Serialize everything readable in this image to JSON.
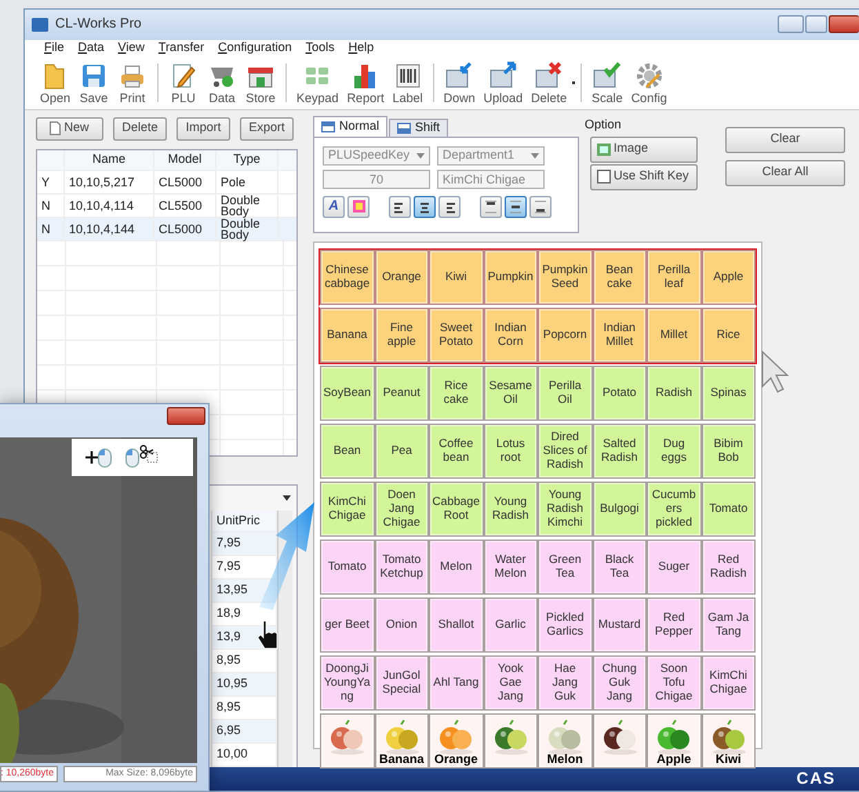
{
  "window": {
    "title": "CL-Works Pro"
  },
  "menu": [
    "File",
    "Data",
    "View",
    "Transfer",
    "Configuration",
    "Tools",
    "Help"
  ],
  "toolbar_groups": [
    [
      "Open",
      "Save",
      "Print"
    ],
    [
      "PLU",
      "Data",
      "Store"
    ],
    [
      "Keypad",
      "Report",
      "Label"
    ],
    [
      "Down",
      "Upload",
      "Delete"
    ],
    [
      "Scale",
      "Config"
    ]
  ],
  "scale_buttons": [
    "New",
    "Delete",
    "Import",
    "Export"
  ],
  "scale_table": {
    "columns": [
      "",
      "Name",
      "Model",
      "Type"
    ],
    "rows": [
      [
        "Y",
        "10,10,5,217",
        "CL5000",
        "Pole"
      ],
      [
        "N",
        "10,10,4,114",
        "CL5500",
        "Double Body"
      ],
      [
        "N",
        "10,10,4,144",
        "CL5000",
        "Double Body"
      ]
    ]
  },
  "price_table": {
    "column": "UnitPric",
    "values": [
      "7,95",
      "7,95",
      "13,95",
      "18,9",
      "13,9",
      "8,95",
      "10,95",
      "8,95",
      "6,95",
      "10,00"
    ]
  },
  "tabs": [
    {
      "label": "Normal",
      "selected": true
    },
    {
      "label": "Shift",
      "selected": false
    }
  ],
  "selects": [
    "PLUSpeedKey",
    "Department1"
  ],
  "fields": [
    "70",
    "KimChi Chigae"
  ],
  "style_buttons": [
    {
      "kind": "font",
      "label": "A"
    },
    {
      "kind": "color"
    }
  ],
  "align_buttons": [
    {
      "selected": false
    },
    {
      "selected": true
    },
    {
      "selected": false
    }
  ],
  "valign_buttons": [
    {
      "selected": false
    },
    {
      "selected": true
    },
    {
      "selected": false
    }
  ],
  "option": {
    "title": "Option",
    "buttons": [
      "Image",
      "Use Shift Key"
    ]
  },
  "clear_buttons": [
    "Clear",
    "Clear All"
  ],
  "key_rows": [
    {
      "kind": "text",
      "color": "#fcd27c",
      "selected": true,
      "keys": [
        "Chinese cabbage",
        "Orange",
        "Kiwi",
        "Pumpkin",
        "Pumpkin Seed",
        "Bean cake",
        "Perilla leaf",
        "Apple"
      ]
    },
    {
      "kind": "text",
      "color": "#fcd27c",
      "selected": true,
      "keys": [
        "Banana",
        "Fine apple",
        "Sweet Potato",
        "Indian Corn",
        "Popcorn",
        "Indian Millet",
        "Millet",
        "Rice"
      ]
    },
    {
      "kind": "text",
      "color": "#d3f59a",
      "selected": false,
      "keys": [
        "SoyBean",
        "Peanut",
        "Rice cake",
        "Sesame Oil",
        "Perilla Oil",
        "Potato",
        "Radish",
        "Spinas"
      ]
    },
    {
      "kind": "text",
      "color": "#d3f59a",
      "selected": false,
      "keys": [
        "Bean",
        "Pea",
        "Coffee bean",
        "Lotus root",
        "Dired Slices of Radish",
        "Salted Radish",
        "Dug eggs",
        "Bibim Bob"
      ]
    },
    {
      "kind": "text",
      "color": "#d3f59a",
      "selected": false,
      "keys": [
        "KimChi Chigae",
        "Doen Jang Chigae",
        "Cabbage Root",
        "Young Radish",
        "Young Radish Kimchi",
        "Bulgogi",
        "Cucumbers pickled",
        "Tomato"
      ]
    },
    {
      "kind": "text",
      "color": "#fcd4f6",
      "selected": false,
      "keys": [
        "Tomato",
        "Tomato Ketchup",
        "Melon",
        "Water Melon",
        "Green Tea",
        "Black Tea",
        "Suger",
        "Red Radish"
      ]
    },
    {
      "kind": "text",
      "color": "#fcd4f6",
      "selected": false,
      "keys": [
        "ger Beet",
        "Onion",
        "Shallot",
        "Garlic",
        "Pickled Garlics",
        "Mustard",
        "Red Pepper",
        "Gam Ja Tang"
      ]
    },
    {
      "kind": "text",
      "color": "#fcd4f6",
      "selected": false,
      "keys": [
        "DoongJi YoungYang",
        "JunGol Special",
        "Ahl Tang",
        "Yook Gae Jang",
        "Hae Jang Guk",
        "Chung Guk Jang",
        "Soon Tofu Chigae",
        "KimChi Chigae"
      ]
    },
    {
      "kind": "picture",
      "color": "#fff4f2",
      "selected": false,
      "keys": [
        {
          "kind": "picture"
        },
        {
          "kind": "picture",
          "label": "Banana"
        },
        {
          "kind": "picture",
          "label": "Orange"
        },
        {
          "kind": "picture"
        },
        {
          "kind": "picture",
          "label": "Melon"
        },
        {
          "kind": "picture"
        },
        {
          "kind": "picture",
          "label": "Apple"
        },
        {
          "kind": "picture",
          "label": "Kiwi"
        }
      ]
    }
  ],
  "image_editor": {
    "status": [
      {
        "kind": "size",
        "text": ": 10,260byte"
      },
      {
        "kind": "max",
        "text": "Max Size: 8,096byte"
      }
    ]
  },
  "footer": {
    "logo": "CAS"
  }
}
